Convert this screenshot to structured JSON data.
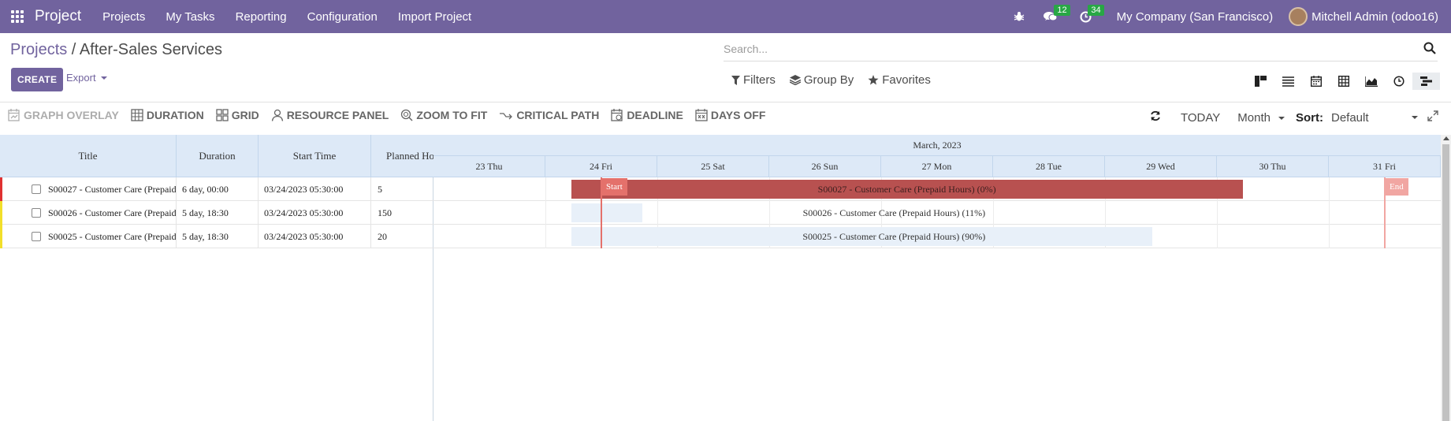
{
  "navbar": {
    "brand": "Project",
    "menu": [
      "Projects",
      "My Tasks",
      "Reporting",
      "Configuration",
      "Import Project"
    ],
    "messages_count": "12",
    "activities_count": "34",
    "company": "My Company (San Francisco)",
    "user": "Mitchell Admin (odoo16)"
  },
  "breadcrumb": {
    "parent": "Projects",
    "separator": " / ",
    "current": "After-Sales Services"
  },
  "search": {
    "placeholder": "Search..."
  },
  "buttons": {
    "create": "CREATE",
    "export": "Export"
  },
  "filters": {
    "filters": "Filters",
    "group_by": "Group By",
    "favorites": "Favorites"
  },
  "views": [
    "kanban-icon",
    "list-icon",
    "calendar-icon",
    "pivot-icon",
    "graph-icon",
    "activity-icon",
    "gantt-icon"
  ],
  "gantt_toolbar": {
    "graph_overlay": "GRAPH OVERLAY",
    "duration": "DURATION",
    "grid": "GRID",
    "resource_panel": "RESOURCE PANEL",
    "zoom_to_fit": "ZOOM TO FIT",
    "critical_path": "CRITICAL PATH",
    "deadline": "DEADLINE",
    "days_off": "DAYS OFF",
    "today": "TODAY",
    "scale": "Month",
    "sort_label": "Sort:",
    "sort_value": "Default"
  },
  "table": {
    "columns": [
      "Title",
      "Duration",
      "Start Time",
      "Planned Hou"
    ],
    "rows": [
      {
        "title": "S00027 - Customer Care (Prepaid",
        "duration": "6 day, 00:00",
        "start": "03/24/2023 05:30:00",
        "planned": "5",
        "color": "#e03131"
      },
      {
        "title": "S00026 - Customer Care (Prepaid",
        "duration": "5 day, 18:30",
        "start": "03/24/2023 05:30:00",
        "planned": "150",
        "color": "#f2df2a"
      },
      {
        "title": "S00025 - Customer Care (Prepaid",
        "duration": "5 day, 18:30",
        "start": "03/24/2023 05:30:00",
        "planned": "20",
        "color": "#f2df2a"
      }
    ]
  },
  "chart_header": {
    "month": "March, 2023",
    "days": [
      "23 Thu",
      "24 Fri",
      "25 Sat",
      "26 Sun",
      "27 Mon",
      "28 Tue",
      "29 Wed",
      "30 Thu",
      "31 Fri"
    ]
  },
  "tasks": [
    {
      "label": "S00027 - Customer Care (Prepaid Hours) (0%)",
      "start_day": 24.23,
      "end_day": 30.23,
      "progress": 0,
      "color": "#b85150"
    },
    {
      "label": "S00026 - Customer Care (Prepaid Hours) (11%)",
      "start_day": 24.23,
      "end_day": 30.0,
      "progress": 11,
      "color": "#e8f0f9"
    },
    {
      "label": "S00025 - Customer Care (Prepaid Hours) (90%)",
      "start_day": 24.23,
      "end_day": 30.0,
      "progress": 90,
      "color": "#e8f0f9"
    }
  ],
  "markers": {
    "start": "Start",
    "end": "End",
    "start_day": 24.5,
    "end_day": 31.5
  }
}
